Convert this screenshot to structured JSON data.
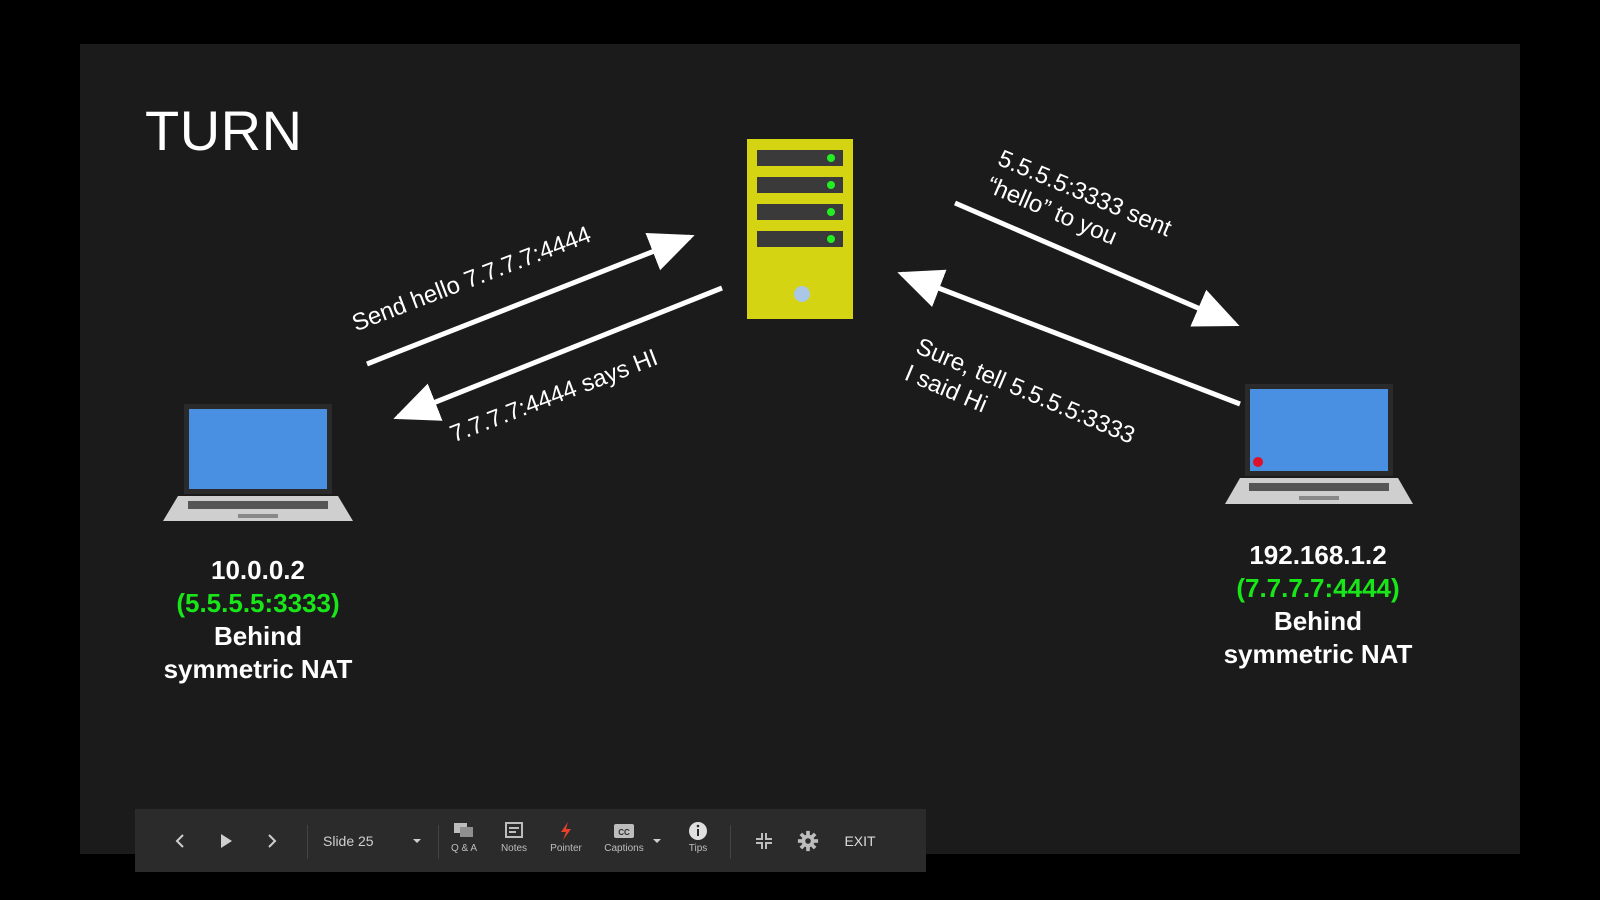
{
  "slide": {
    "title": "TURN",
    "arrow_labels": {
      "left_top": "Send hello 7.7.7.7:4444",
      "left_bottom": "7.7.7.7:4444 says HI",
      "right_top_line1": "5.5.5.5:3333 sent",
      "right_top_line2": "“hello” to you",
      "right_bottom_line1": "Sure, tell 5.5.5.5:3333",
      "right_bottom_line2": "I said Hi"
    },
    "left_peer": {
      "ip": "10.0.0.2",
      "public": "(5.5.5.5:3333)",
      "line3": "Behind",
      "line4": "symmetric NAT"
    },
    "right_peer": {
      "ip": "192.168.1.2",
      "public": "(7.7.7.7:4444)",
      "line3": "Behind",
      "line4": "symmetric NAT"
    },
    "colors": {
      "server_body": "#d4d412",
      "laptop_screen": "#4a90e2",
      "address_green": "#19e619",
      "pointer_dot": "#e0102a"
    }
  },
  "toolbar": {
    "prev_icon": "chevron-left-icon",
    "play_icon": "play-icon",
    "next_icon": "chevron-right-icon",
    "slide_label": "Slide 25",
    "qa_label": "Q & A",
    "notes_label": "Notes",
    "pointer_label": "Pointer",
    "captions_label": "Captions",
    "tips_label": "Tips",
    "exit_label": "EXIT"
  }
}
